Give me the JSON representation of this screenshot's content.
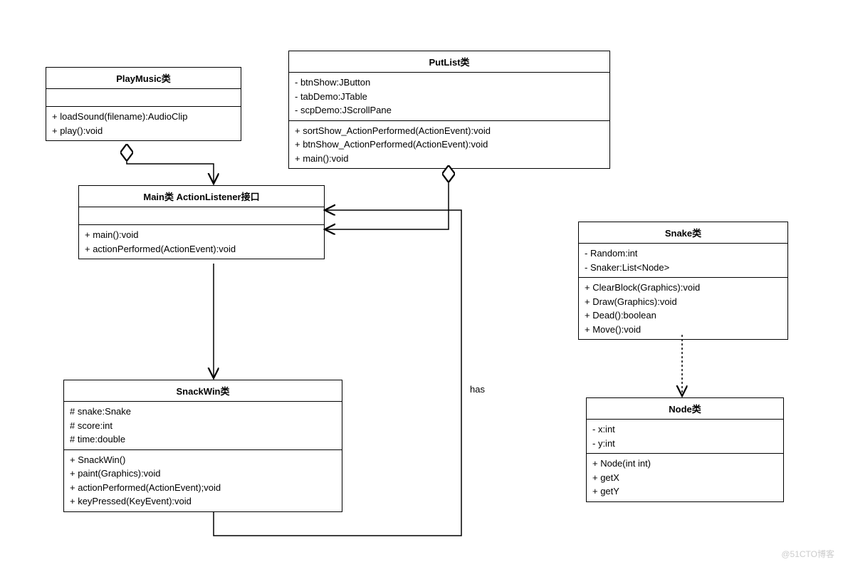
{
  "chart_data": {
    "type": "uml-class-diagram",
    "classes": [
      {
        "name": "PlayMusic类",
        "attributes": [],
        "operations": [
          "+ loadSound(filename):AudioClip",
          "+ play():void"
        ]
      },
      {
        "name": "PutList类",
        "attributes": [
          "- btnShow:JButton",
          "- tabDemo:JTable",
          "- scpDemo:JScrollPane"
        ],
        "operations": [
          "+ sortShow_ActionPerformed(ActionEvent):void",
          "+ btnShow_ActionPerformed(ActionEvent):void",
          "+ main():void"
        ]
      },
      {
        "name": "Main类 ActionListener接口",
        "attributes": [],
        "operations": [
          "+ main():void",
          "+ actionPerformed(ActionEvent):void"
        ]
      },
      {
        "name": "Snake类",
        "attributes": [
          "- Random:int",
          "- Snaker:List<Node>"
        ],
        "operations": [
          "+ ClearBlock(Graphics):void",
          "+ Draw(Graphics):void",
          "+ Dead():boolean",
          "+ Move():void"
        ]
      },
      {
        "name": "SnackWin类",
        "attributes": [
          "# snake:Snake",
          "# score:int",
          "# time:double"
        ],
        "operations": [
          "+ SnackWin()",
          "+ paint(Graphics):void",
          "+ actionPerformed(ActionEvent);void",
          "+ keyPressed(KeyEvent):void"
        ]
      },
      {
        "name": "Node类",
        "attributes": [
          "- x:int",
          "- y:int"
        ],
        "operations": [
          "+ Node(int int)",
          "+ getX",
          "+ getY"
        ]
      }
    ],
    "relations": [
      {
        "from": "PlayMusic类",
        "to": "Main类 ActionListener接口",
        "type": "aggregation"
      },
      {
        "from": "PutList类",
        "to": "Main类 ActionListener接口",
        "type": "aggregation"
      },
      {
        "from": "Main类 ActionListener接口",
        "to": "SnackWin类",
        "type": "association"
      },
      {
        "from": "SnackWin类",
        "to": "Main类 ActionListener接口",
        "type": "association",
        "label": "has"
      },
      {
        "from": "Snake类",
        "to": "Node类",
        "type": "dependency"
      }
    ]
  },
  "playMusic": {
    "name": "PlayMusic类",
    "m1": "+ loadSound(filename):AudioClip",
    "m2": "+ play():void"
  },
  "putList": {
    "name": "PutList类",
    "a1": "- btnShow:JButton",
    "a2": "- tabDemo:JTable",
    "a3": "- scpDemo:JScrollPane",
    "m1": "+ sortShow_ActionPerformed(ActionEvent):void",
    "m2": "+ btnShow_ActionPerformed(ActionEvent):void",
    "m3": "+ main():void"
  },
  "main": {
    "name": "Main类 ActionListener接口",
    "m1": "+ main():void",
    "m2": "+ actionPerformed(ActionEvent):void"
  },
  "snake": {
    "name": "Snake类",
    "a1": "- Random:int",
    "a2": "- Snaker:List<Node>",
    "m1": "+ ClearBlock(Graphics):void",
    "m2": "+ Draw(Graphics):void",
    "m3": "+ Dead():boolean",
    "m4": "+ Move():void"
  },
  "snackWin": {
    "name": "SnackWin类",
    "a1": "# snake:Snake",
    "a2": "# score:int",
    "a3": "# time:double",
    "m1": "+ SnackWin()",
    "m2": "+ paint(Graphics):void",
    "m3": "+ actionPerformed(ActionEvent);void",
    "m4": "+ keyPressed(KeyEvent):void"
  },
  "node": {
    "name": "Node类",
    "a1": "- x:int",
    "a2": "- y:int",
    "m1": "+ Node(int int)",
    "m2": "+ getX",
    "m3": "+ getY"
  },
  "labels": {
    "has": "has"
  },
  "watermark": "@51CTO博客"
}
